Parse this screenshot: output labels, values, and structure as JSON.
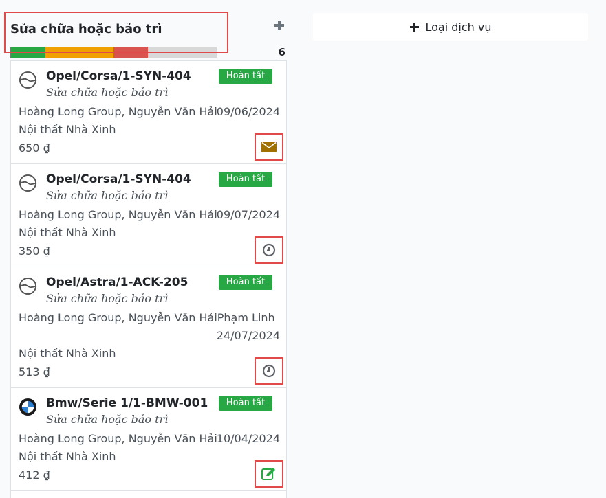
{
  "column": {
    "title": "Sửa chữa hoặc bảo trì",
    "count": "6",
    "progress": [
      {
        "color": "#28a745",
        "fraction": 0.167
      },
      {
        "color": "#f0a000",
        "fraction": 0.333
      },
      {
        "color": "#d9534f",
        "fraction": 0.167
      },
      {
        "color": "#d8d8d8",
        "fraction": 0.333
      }
    ]
  },
  "cards": [
    {
      "title": "Opel/Corsa/1-SYN-404",
      "subtitle": "Sửa chữa hoặc bảo trì",
      "status": "Hoàn tất",
      "customer": "Hoàng Long Group, Nguyễn Văn Hải",
      "date": "09/06/2024",
      "company": "Nội thất Nhà Xinh",
      "price": "650 ₫",
      "logo": "opel-logo-icon",
      "activity_icon": "envelope-icon",
      "activity_color": "#a07000"
    },
    {
      "title": "Opel/Corsa/1-SYN-404",
      "subtitle": "Sửa chữa hoặc bảo trì",
      "status": "Hoàn tất",
      "customer": "Hoàng Long Group, Nguyễn Văn Hải",
      "date": "09/07/2024",
      "company": "Nội thất Nhà Xinh",
      "price": "350 ₫",
      "logo": "opel-logo-icon",
      "activity_icon": "clock-icon",
      "activity_color": "#5f6368"
    },
    {
      "title": "Opel/Astra/1-ACK-205",
      "subtitle": "Sửa chữa hoặc bảo trì",
      "status": "Hoàn tất",
      "customer": "Hoàng Long Group, Nguyễn Văn HảiPhạm Linh",
      "date": "24/07/2024",
      "company": "Nội thất Nhà Xinh",
      "price": "513 ₫",
      "logo": "opel-logo-icon",
      "activity_icon": "clock-icon",
      "activity_color": "#5f6368"
    },
    {
      "title": "Bmw/Serie 1/1-BMW-001",
      "subtitle": "Sửa chữa hoặc bảo trì",
      "status": "Hoàn tất",
      "customer": "Hoàng Long Group, Nguyễn Văn Hải",
      "date": "10/04/2024",
      "company": "Nội thất Nhà Xinh",
      "price": "412 ₫",
      "logo": "bmw-logo-icon",
      "activity_icon": "edit-icon",
      "activity_color": "#28a745"
    }
  ],
  "add_type": {
    "label": "Loại dịch vụ"
  }
}
